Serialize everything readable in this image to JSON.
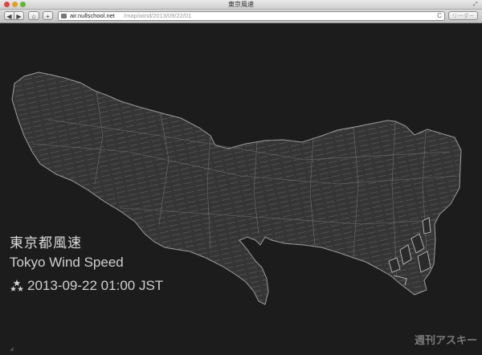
{
  "window": {
    "title": "東京風速"
  },
  "toolbar": {
    "back_icon": "◀",
    "forward_icon": "▶",
    "home_icon": "⌂",
    "add_icon": "+",
    "url_host": "air.nullschool.net",
    "url_path": "/map/wind/2013/09/22/01",
    "reload_icon": "C",
    "reader_label": "リーダー"
  },
  "overlay": {
    "title_jp": "東京都風速",
    "title_en": "Tokyo Wind Speed",
    "datetime": "2013-09-22 01:00 JST"
  },
  "watermark": "週刊アスキー",
  "colors": {
    "background": "#1c1c1c",
    "map_fill": "#3a3a3a",
    "map_stroke": "#9a9a9a",
    "text": "#d0d0d0"
  }
}
